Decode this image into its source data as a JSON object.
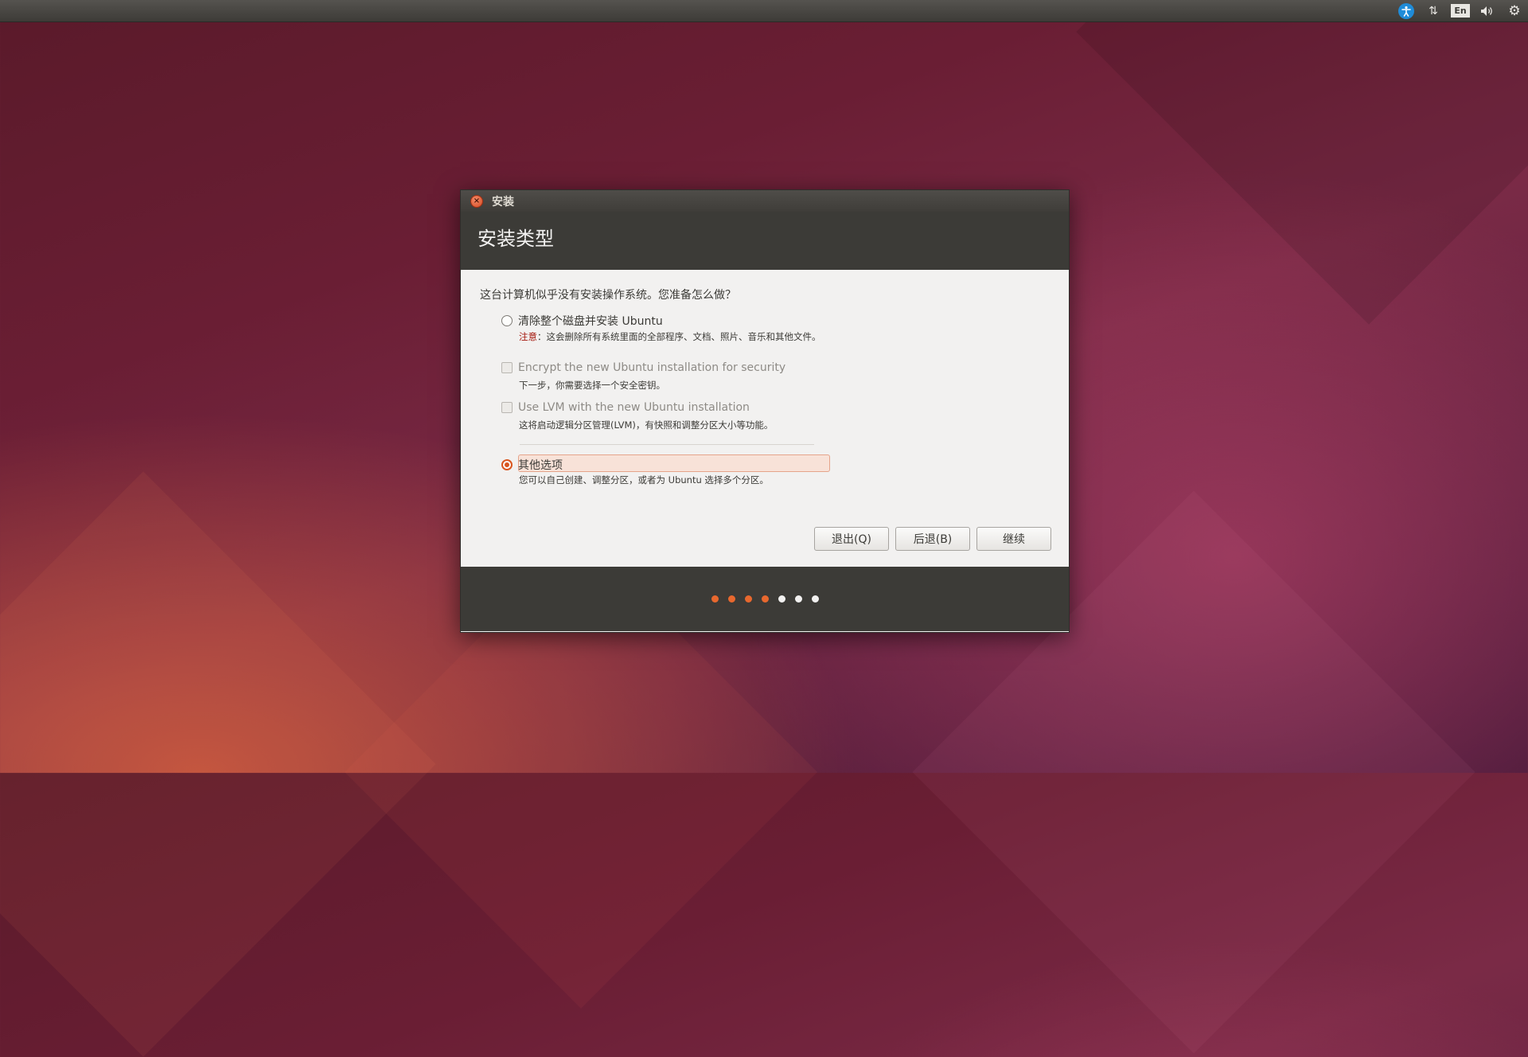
{
  "panel": {
    "tray": [
      {
        "icon": "accessibility-icon"
      },
      {
        "icon": "network-icon",
        "glyph": "⇅"
      },
      {
        "icon": "keyboard-layout-icon",
        "label": "En"
      },
      {
        "icon": "volume-icon",
        "glyph": "🔊"
      },
      {
        "icon": "settings-gear-icon",
        "glyph": "⚙"
      }
    ]
  },
  "window": {
    "title": "安装",
    "close_icon": "close-icon"
  },
  "header": {
    "title": "安装类型"
  },
  "content": {
    "question": "这台计算机似乎没有安装操作系统。您准备怎么做？",
    "options": [
      {
        "type": "radio",
        "label": "清除整个磁盘并安装 Ubuntu",
        "checked": false,
        "desc_warn": "注意",
        "desc": "：这会删除所有系统里面的全部程序、文档、照片、音乐和其他文件。"
      },
      {
        "type": "checkbox",
        "label": "Encrypt the new Ubuntu installation for security",
        "disabled": true,
        "desc": "下一步，你需要选择一个安全密钥。"
      },
      {
        "type": "checkbox",
        "label": "Use LVM with the new Ubuntu installation",
        "disabled": true,
        "desc": "这将启动逻辑分区管理(LVM)，有快照和调整分区大小等功能。"
      },
      {
        "type": "radio",
        "label": "其他选项",
        "checked": true,
        "desc": "您可以自己创建、调整分区，或者为 Ubuntu 选择多个分区。"
      }
    ]
  },
  "buttons": {
    "quit": "退出(Q)",
    "back": "后退(B)",
    "continue": "继续"
  },
  "progress": {
    "total_steps": 7,
    "completed_steps": 4,
    "colors": {
      "done": "#e8682e",
      "todo": "#f2f1f0"
    }
  }
}
